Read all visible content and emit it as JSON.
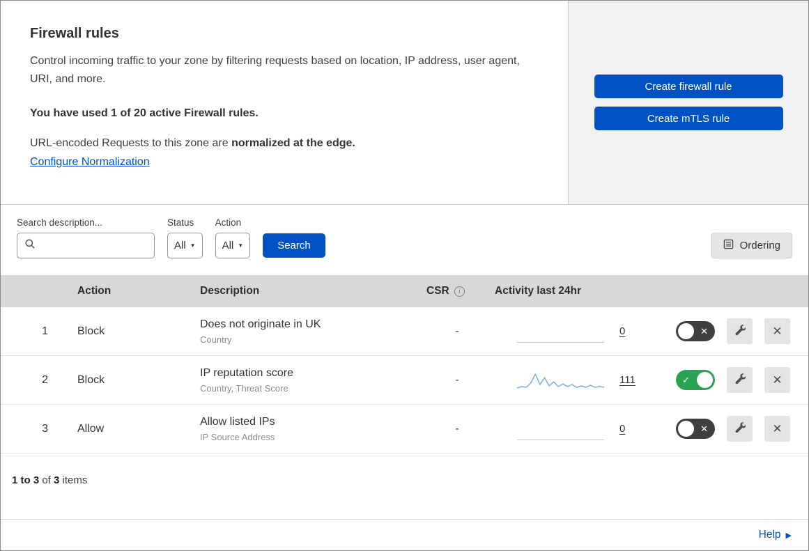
{
  "header": {
    "title": "Firewall rules",
    "description": "Control incoming traffic to your zone by filtering requests based on location, IP address, user agent, URI, and more.",
    "usage": "You have used 1 of 20 active Firewall rules.",
    "normalization_prefix": "URL-encoded Requests to this zone are ",
    "normalization_bold": "normalized at the edge.",
    "normalization_link": "Configure Normalization",
    "buttons": {
      "create_firewall_rule": "Create firewall rule",
      "create_mtls_rule": "Create mTLS rule"
    }
  },
  "filters": {
    "search_label": "Search description...",
    "status": {
      "label": "Status",
      "value": "All"
    },
    "action": {
      "label": "Action",
      "value": "All"
    },
    "search_button": "Search",
    "ordering_button": "Ordering"
  },
  "table": {
    "headers": {
      "action": "Action",
      "description": "Description",
      "csr": "CSR",
      "activity": "Activity last 24hr"
    },
    "rows": [
      {
        "index": "1",
        "action": "Block",
        "description": "Does not originate in UK",
        "fields": "Country",
        "csr": "-",
        "activity_count": "0",
        "enabled": false
      },
      {
        "index": "2",
        "action": "Block",
        "description": "IP reputation score",
        "fields": "Country, Threat Score",
        "csr": "-",
        "activity_count": "111",
        "enabled": true,
        "sparkline": [
          27,
          25,
          26,
          20,
          7,
          22,
          12,
          24,
          18,
          25,
          21,
          25,
          22,
          26,
          24,
          26,
          23,
          26,
          25,
          26
        ]
      },
      {
        "index": "3",
        "action": "Allow",
        "description": "Allow listed IPs",
        "fields": "IP Source Address",
        "csr": "-",
        "activity_count": "0",
        "enabled": false
      }
    ],
    "summary": {
      "range": "1 to 3",
      "of": " of ",
      "total": "3",
      "items": " items"
    }
  },
  "help": {
    "label": "Help"
  },
  "icons": {
    "info": "i",
    "dropdown_caret": "▼",
    "toggle_check": "✓",
    "toggle_x": "✕",
    "close": "✕",
    "help_arrow": "▶"
  },
  "colors": {
    "primary_blue": "#0051c3",
    "toggle_on_green": "#2aa254",
    "toggle_off_dark": "#3f3f3f",
    "sparkline_blue": "#78aede"
  }
}
